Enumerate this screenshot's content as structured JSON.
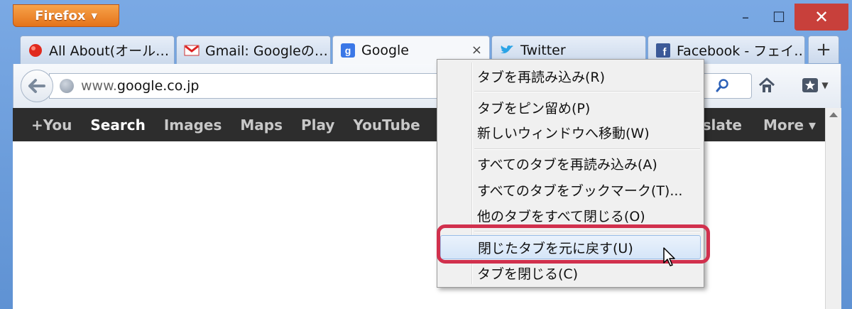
{
  "app_button": {
    "label": "Firefox",
    "caret": "▼"
  },
  "window_controls": {
    "minimize": "–",
    "maximize": "☐",
    "close": "✕"
  },
  "tabs": [
    {
      "label": "All About(オール…",
      "icon": "allabout-red-dot-icon"
    },
    {
      "label": "Gmail: Googleの…",
      "icon": "gmail-m-icon"
    },
    {
      "label": "Google",
      "icon": "google-g-icon",
      "active": true,
      "close": "×"
    },
    {
      "label": "Twitter",
      "icon": "twitter-bird-icon"
    },
    {
      "label": "Facebook - フェイ…",
      "icon": "facebook-f-icon"
    }
  ],
  "new_tab": "+",
  "urlbar": {
    "host_prefix": "www.",
    "host_main": "google.co.jp"
  },
  "google_bar": {
    "items": [
      "+You",
      "Search",
      "Images",
      "Maps",
      "Play",
      "YouTube"
    ],
    "selected": "Search",
    "translate_partial": "nslate",
    "more": "More ▾"
  },
  "context_menu": {
    "items": [
      "タブを再読み込み(R)",
      "タブをピン留め(P)",
      "新しいウィンドウへ移動(W)",
      "すべてのタブを再読み込み(A)",
      "すべてのタブをブックマーク(T)...",
      "他のタブをすべて閉じる(O)",
      "閉じたタブを元に戻す(U)",
      "タブを閉じる(C)"
    ],
    "hovered_index": 6
  },
  "colors": {
    "frame": "#6f9fd9",
    "app_button": "#e5731a",
    "close_button": "#c8403b",
    "google_bar": "#2d2d2d",
    "highlight": "#d1304d"
  }
}
